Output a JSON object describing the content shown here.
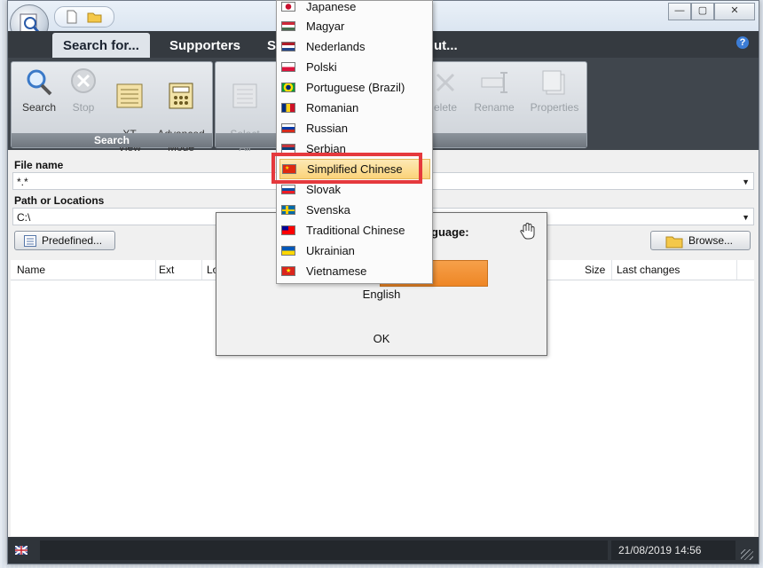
{
  "window": {
    "tabs": [
      "Search for...",
      "Supporters",
      "S",
      "ut..."
    ],
    "help_glyph": "?",
    "controls": [
      "—",
      "▢",
      "✕"
    ]
  },
  "ribbon": {
    "search_group": {
      "title": "Search",
      "buttons": [
        {
          "label": "Search",
          "icon": "magnifier-icon"
        },
        {
          "label": "Stop",
          "icon": "stop-icon"
        },
        {
          "label": "XT\nView",
          "icon": "xt-view-icon"
        },
        {
          "label": "Advanced\nMode",
          "icon": "advanced-mode-icon"
        }
      ]
    },
    "select_group": {
      "title_tail": "s",
      "buttons": [
        {
          "label": "Select\nAll",
          "icon": "select-all-icon"
        },
        {
          "label": "elete",
          "icon": "delete-icon"
        },
        {
          "label": "Rename",
          "icon": "rename-icon"
        },
        {
          "label": "Properties",
          "icon": "properties-icon"
        }
      ]
    }
  },
  "search_form": {
    "file_name_label": "File name",
    "file_name_value": "*.*",
    "path_label": "Path or Locations",
    "path_value": "C:\\",
    "predefined_button": "Predefined...",
    "browse_button": "Browse..."
  },
  "results": {
    "columns": [
      "Name",
      "Ext",
      "Lo",
      "Size",
      "Last changes"
    ]
  },
  "status_bar": {
    "datetime": "21/08/2019 14:56"
  },
  "dialog": {
    "prompt_tail": "guage:",
    "current_language": "English",
    "ok_button": "OK"
  },
  "language_menu": {
    "items": [
      {
        "label": "Japanese",
        "flag": "jp"
      },
      {
        "label": "Magyar",
        "flag": "hu"
      },
      {
        "label": "Nederlands",
        "flag": "nl"
      },
      {
        "label": "Polski",
        "flag": "pl"
      },
      {
        "label": "Portuguese (Brazil)",
        "flag": "br"
      },
      {
        "label": "Romanian",
        "flag": "ro"
      },
      {
        "label": "Russian",
        "flag": "ru"
      },
      {
        "label": "Serbian",
        "flag": "rs"
      },
      {
        "label": "Simplified Chinese",
        "flag": "cn"
      },
      {
        "label": "Slovak",
        "flag": "sk"
      },
      {
        "label": "Svenska",
        "flag": "se"
      },
      {
        "label": "Traditional Chinese",
        "flag": "tw"
      },
      {
        "label": "Ukrainian",
        "flag": "ua"
      },
      {
        "label": "Vietnamese",
        "flag": "vn"
      }
    ],
    "selected_index": 8
  },
  "colors": {
    "accent_highlight": "#e5393d",
    "menu_selection": "#fbd37a",
    "dark_chrome": "#353a40",
    "orange_bar": "#f0892a"
  }
}
